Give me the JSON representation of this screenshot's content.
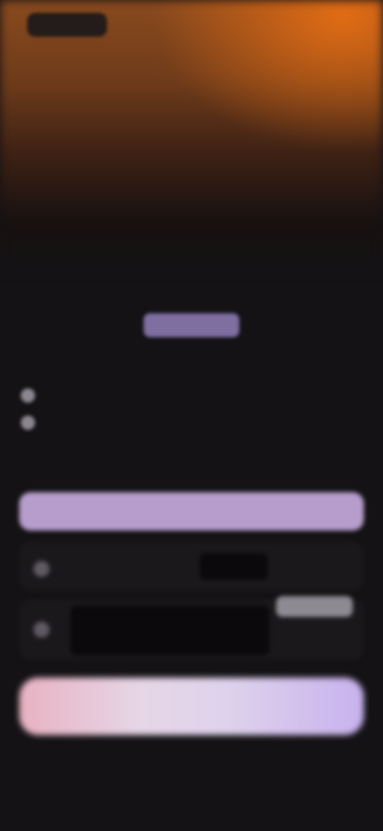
{
  "header": {
    "logo_text": "",
    "top_link": ""
  },
  "hero": {
    "headline": "",
    "plan_pill": ""
  },
  "pricing": {
    "left": "",
    "mid": "",
    "right": ""
  },
  "features": [
    {
      "text": ""
    },
    {
      "text": ""
    }
  ],
  "cta_primary": {
    "label": ""
  },
  "options": [
    {
      "title": "",
      "subtitle": "",
      "price": ""
    },
    {
      "title": "",
      "subtitle": "",
      "price": "",
      "badge": ""
    }
  ],
  "cta_secondary": {
    "label": ""
  },
  "footer": {
    "note_1": "",
    "note_2": ""
  },
  "colors": {
    "accent_orange": "#e66e14",
    "accent_purple": "#b69dcc",
    "background": "#141215"
  }
}
